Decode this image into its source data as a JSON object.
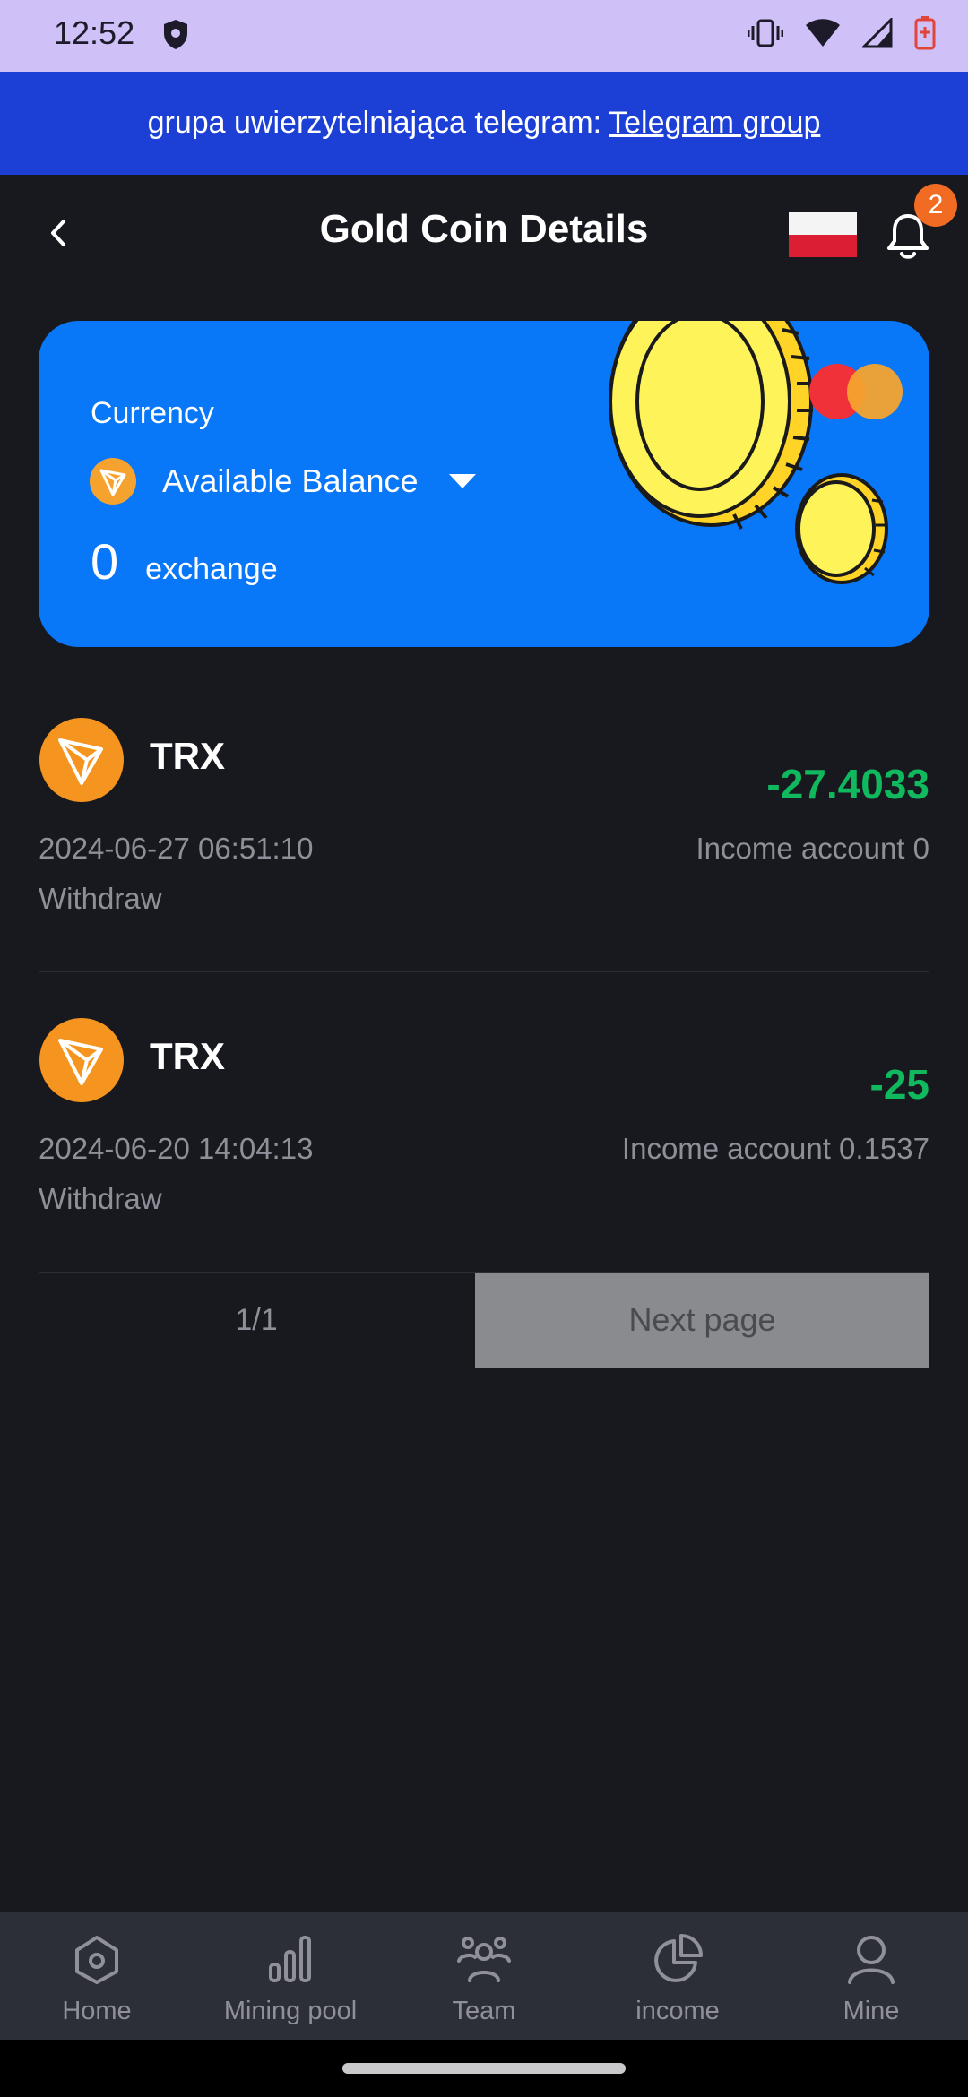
{
  "status_bar": {
    "time": "12:52"
  },
  "banner": {
    "text": "grupa uwierzytelniająca telegram:",
    "link": "Telegram group"
  },
  "header": {
    "title": "Gold Coin Details",
    "notification_count": "2"
  },
  "balance_card": {
    "currency_label": "Currency",
    "selected": "Available Balance",
    "amount": "0",
    "exchange_label": "exchange"
  },
  "transactions": [
    {
      "symbol": "TRX",
      "amount": "-27.4033",
      "date": "2024-06-27 06:51:10",
      "account": "Income account 0",
      "type": "Withdraw"
    },
    {
      "symbol": "TRX",
      "amount": "-25",
      "date": "2024-06-20 14:04:13",
      "account": "Income account 0.1537",
      "type": "Withdraw"
    }
  ],
  "pagination": {
    "indicator": "1/1",
    "next_label": "Next page"
  },
  "nav": [
    {
      "label": "Home",
      "icon": "home-icon"
    },
    {
      "label": "Mining pool",
      "icon": "bar-chart-icon"
    },
    {
      "label": "Team",
      "icon": "team-icon"
    },
    {
      "label": "income",
      "icon": "pie-chart-icon"
    },
    {
      "label": "Mine",
      "icon": "user-icon"
    }
  ],
  "colors": {
    "banner": "#1c3fd6",
    "card": "#0877f8",
    "negative_amount": "#10b85e",
    "background": "#18191f"
  }
}
